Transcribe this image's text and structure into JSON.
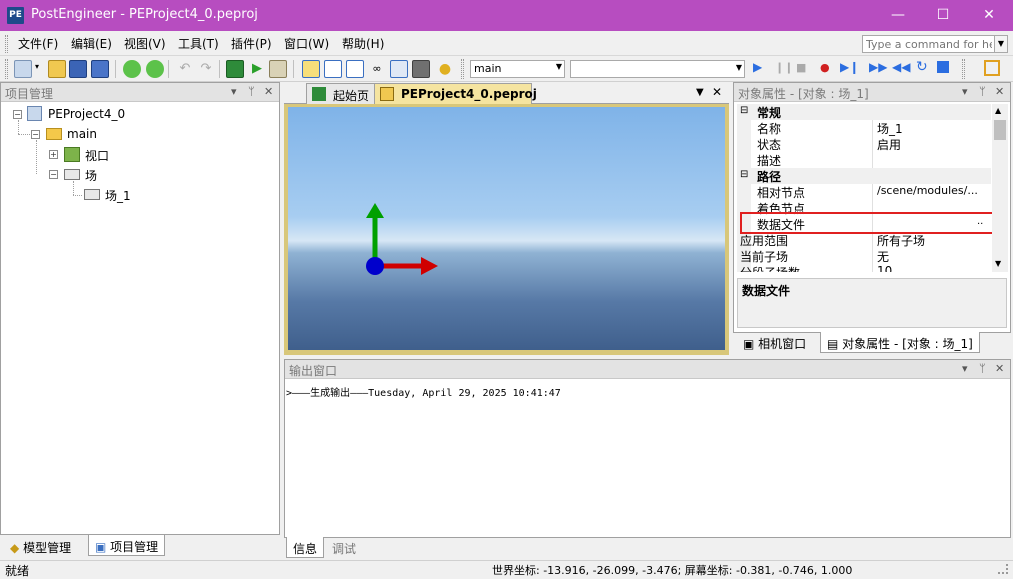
{
  "window": {
    "logo_text": "PE",
    "title": "PostEngineer - PEProject4_0.peproj",
    "minimize": "—",
    "maximize": "☐",
    "close": "✕"
  },
  "menu": {
    "items": [
      {
        "label": "文件(F)"
      },
      {
        "label": "编辑(E)"
      },
      {
        "label": "视图(V)"
      },
      {
        "label": "工具(T)"
      },
      {
        "label": "插件(P)"
      },
      {
        "label": "窗口(W)"
      },
      {
        "label": "帮助(H)"
      }
    ],
    "command_placeholder": "Type a command for help"
  },
  "toolbar": {
    "scene_select_value": "main"
  },
  "project_panel": {
    "title": "项目管理",
    "tree": {
      "root": "PEProject4_0",
      "main": "main",
      "viewport": "视口",
      "field": "场",
      "field_1": "场_1"
    },
    "tabs": [
      {
        "label": "模型管理"
      },
      {
        "label": "项目管理"
      }
    ]
  },
  "document": {
    "tabs": [
      {
        "label": "起始页"
      },
      {
        "label": "PEProject4_0.peproj"
      }
    ]
  },
  "property_panel": {
    "title": "对象属性 - [对象 : 场_1]",
    "categories": {
      "general": "常规",
      "path": "路径"
    },
    "rows": [
      {
        "name": "名称",
        "value": "场_1"
      },
      {
        "name": "状态",
        "value": "启用"
      },
      {
        "name": "描述",
        "value": ""
      },
      {
        "name": "相对节点",
        "value": "/scene/modules/..."
      },
      {
        "name": "着色节点",
        "value": ""
      },
      {
        "name": "数据文件",
        "value": ""
      },
      {
        "name": "应用范围",
        "value": "所有子场"
      },
      {
        "name": "当前子场",
        "value": "无"
      },
      {
        "name": "分段子场数",
        "value": "10"
      }
    ],
    "ellipsis": "..",
    "description_title": "数据文件",
    "tabs": [
      {
        "label": "相机窗口"
      },
      {
        "label": "对象属性 - [对象 : 场_1]"
      }
    ]
  },
  "output_panel": {
    "title": "输出窗口",
    "line": ">———生成输出———Tuesday, April 29, 2025 10:41:47",
    "tabs": [
      {
        "label": "信息"
      },
      {
        "label": "调试"
      }
    ]
  },
  "status": {
    "left": "就绪",
    "coords": "世界坐标: -13.916, -26.099, -3.476; 屏幕坐标: -0.381, -0.746, 1.000"
  },
  "colors": {
    "titlebar": "#b74dc0",
    "highlight_box": "#e02020",
    "axis_y": "#00a000",
    "axis_x": "#d00000",
    "axis_origin": "#0000cc"
  }
}
